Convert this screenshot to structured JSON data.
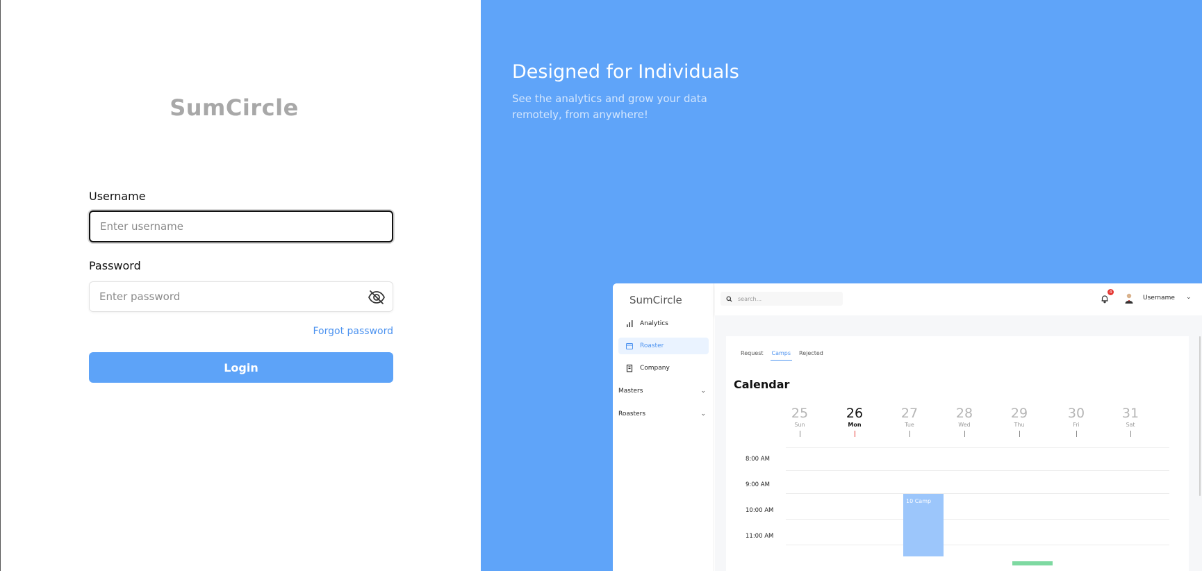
{
  "login": {
    "brand": "SumCircle",
    "username_label": "Username",
    "username_placeholder": "Enter username",
    "password_label": "Password",
    "password_placeholder": "Enter password",
    "forgot_label": "Forgot password",
    "login_label": "Login"
  },
  "hero": {
    "title": "Designed for Individuals",
    "subtitle": "See the analytics and grow your data remotely, from anywhere!"
  },
  "mock": {
    "brand": "SumCircle",
    "search_placeholder": "search...",
    "badge": "4",
    "user": "Username",
    "nav": [
      {
        "label": "Analytics"
      },
      {
        "label": "Roaster"
      },
      {
        "label": "Company"
      }
    ],
    "groups": [
      {
        "label": "Masters"
      },
      {
        "label": "Roasters"
      }
    ],
    "tabs": [
      "Request",
      "Camps",
      "Rejected"
    ],
    "active_tab": "Camps",
    "calendar_title": "Calendar",
    "days": [
      {
        "num": "25",
        "name": "Sun"
      },
      {
        "num": "26",
        "name": "Mon"
      },
      {
        "num": "27",
        "name": "Tue"
      },
      {
        "num": "28",
        "name": "Wed"
      },
      {
        "num": "29",
        "name": "Thu"
      },
      {
        "num": "30",
        "name": "Fri"
      },
      {
        "num": "31",
        "name": "Sat"
      }
    ],
    "times": [
      "8:00 AM",
      "9:00 AM",
      "10:00 AM",
      "11:00 AM"
    ],
    "event": "10 Camp"
  },
  "colors": {
    "primary": "#5da3f8",
    "panel": "#5fa4f9",
    "link": "#4d93f0",
    "brand_grey": "#a8a8a8"
  }
}
